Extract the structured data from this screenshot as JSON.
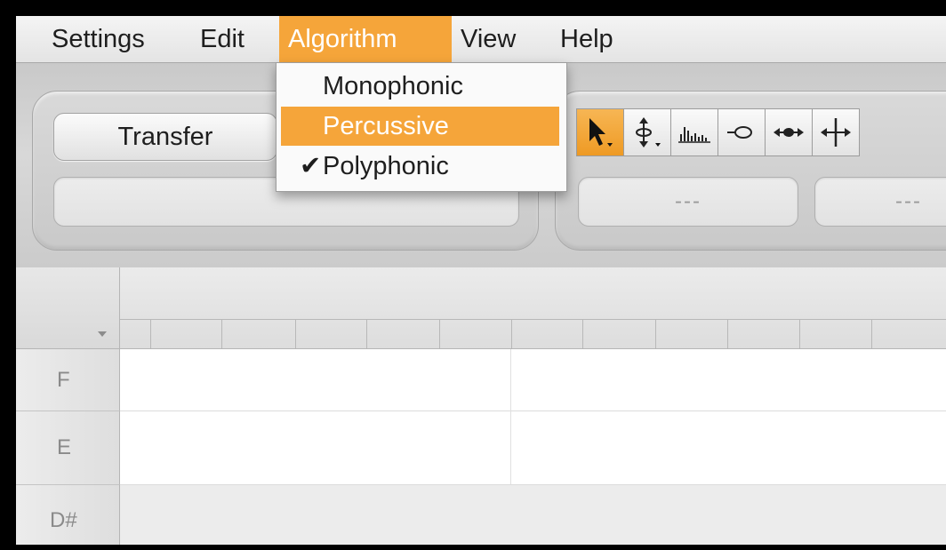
{
  "menubar": {
    "items": [
      {
        "label": "Settings"
      },
      {
        "label": "Edit"
      },
      {
        "label": "Algorithm",
        "active": true
      },
      {
        "label": "View"
      },
      {
        "label": "Help"
      }
    ]
  },
  "dropdown": {
    "items": [
      {
        "label": "Monophonic",
        "checked": false,
        "highlighted": false
      },
      {
        "label": "Percussive",
        "checked": false,
        "highlighted": true
      },
      {
        "label": "Polyphonic",
        "checked": true,
        "highlighted": false
      }
    ],
    "check_glyph": "✔"
  },
  "toolbar": {
    "transfer_label": "Transfer",
    "field_1_value": "---",
    "field_2_value": "---",
    "tools": [
      {
        "icon": "pointer-icon",
        "selected": true
      },
      {
        "icon": "pitch-stretch-icon",
        "selected": false
      },
      {
        "icon": "amplitude-bars-icon",
        "selected": false
      },
      {
        "icon": "note-blob-icon",
        "selected": false
      },
      {
        "icon": "time-stretch-icon",
        "selected": false
      },
      {
        "icon": "split-icon",
        "selected": false
      }
    ]
  },
  "grid": {
    "rows": [
      {
        "label": "F"
      },
      {
        "label": "E"
      },
      {
        "label": "D#"
      }
    ]
  },
  "colors": {
    "accent": "#f5a53a",
    "menu_text": "#1e1e1e",
    "row_label_text": "#8a8a8a"
  }
}
